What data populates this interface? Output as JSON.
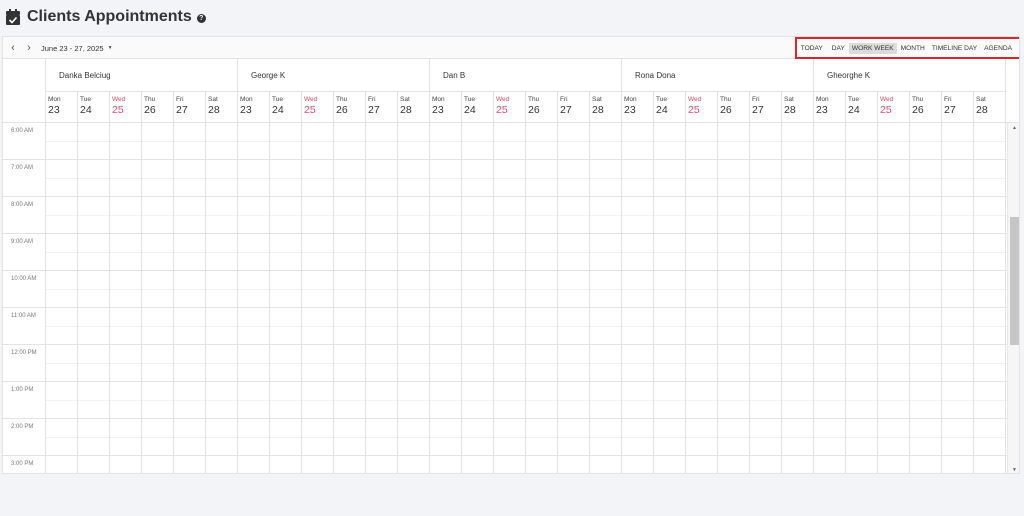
{
  "page": {
    "title": "Clients Appointments"
  },
  "toolbar": {
    "date_range": "June 23 - 27, 2025",
    "views": [
      {
        "label": "TODAY",
        "name": "view-today-button",
        "active": false
      },
      {
        "label": "DAY",
        "name": "view-day-button",
        "active": false
      },
      {
        "label": "WORK WEEK",
        "name": "view-work-week-button",
        "active": true
      },
      {
        "label": "MONTH",
        "name": "view-month-button",
        "active": false
      },
      {
        "label": "TIMELINE DAY",
        "name": "view-timeline-day-button",
        "active": false
      },
      {
        "label": "AGENDA",
        "name": "view-agenda-button",
        "active": false
      }
    ]
  },
  "resources": [
    "Danka Belciug",
    "George K",
    "Dan B",
    "Rona Dona",
    "Gheorghe K"
  ],
  "days": [
    {
      "name": "Mon",
      "num": "23",
      "today": false
    },
    {
      "name": "Tue",
      "num": "24",
      "today": false
    },
    {
      "name": "Wed",
      "num": "25",
      "today": true
    },
    {
      "name": "Thu",
      "num": "26",
      "today": false
    },
    {
      "name": "Fri",
      "num": "27",
      "today": false
    },
    {
      "name": "Sat",
      "num": "28",
      "today": false
    }
  ],
  "times": [
    "6:00 AM",
    "7:00 AM",
    "8:00 AM",
    "9:00 AM",
    "10:00 AM",
    "11:00 AM",
    "12:00 PM",
    "1:00 PM",
    "2:00 PM",
    "3:00 PM"
  ],
  "colors": {
    "today": "#e34a6f",
    "highlight_border": "#d9262c",
    "active_view_bg": "#dcdcdc"
  },
  "icons": {
    "header": "calendar-check-icon",
    "help": "question-circle-icon",
    "prev": "chevron-left-icon",
    "next": "chevron-right-icon",
    "dropdown": "caret-down-icon",
    "scroll_up": "triangle-up-icon",
    "scroll_down": "triangle-down-icon"
  }
}
